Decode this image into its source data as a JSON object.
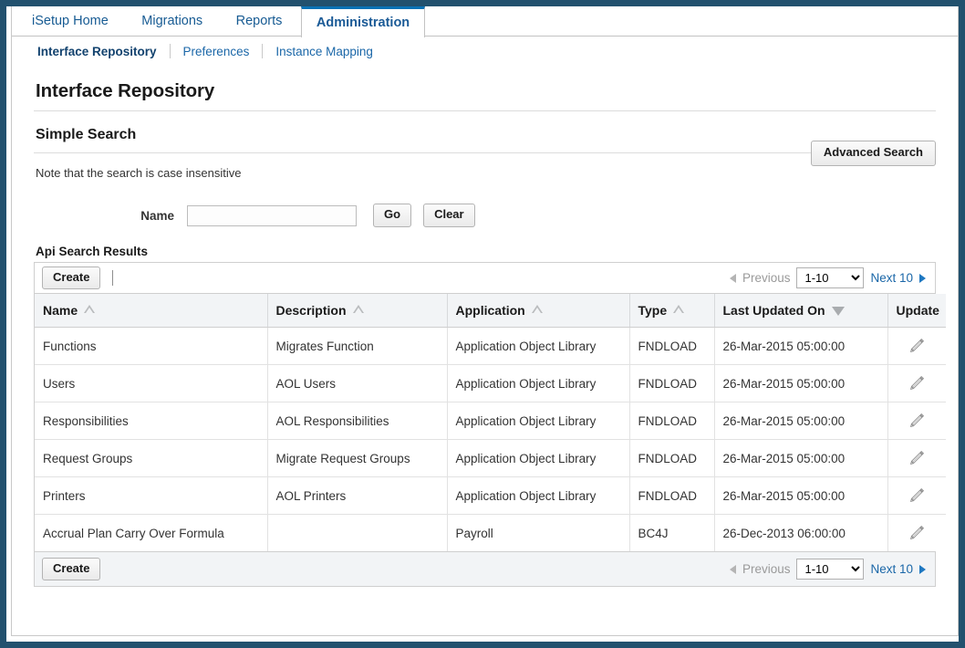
{
  "tabs": [
    {
      "label": "iSetup Home",
      "active": false
    },
    {
      "label": "Migrations",
      "active": false
    },
    {
      "label": "Reports",
      "active": false
    },
    {
      "label": "Administration",
      "active": true
    }
  ],
  "subnav": [
    {
      "label": "Interface Repository",
      "active": true
    },
    {
      "label": "Preferences",
      "active": false
    },
    {
      "label": "Instance Mapping",
      "active": false
    }
  ],
  "page": {
    "title": "Interface Repository",
    "section_title": "Simple Search",
    "note": "Note that the search is case insensitive",
    "results_label": "Api Search Results"
  },
  "search": {
    "advanced_label": "Advanced Search",
    "name_label": "Name",
    "name_value": "",
    "name_placeholder": "",
    "go_label": "Go",
    "clear_label": "Clear"
  },
  "toolbar": {
    "create_label": "Create"
  },
  "pager": {
    "previous_label": "Previous",
    "range_value": "1-10",
    "range_options": [
      "1-10"
    ],
    "next_label": "Next 10"
  },
  "table": {
    "columns": [
      {
        "label": "Name",
        "sort": "asc"
      },
      {
        "label": "Description",
        "sort": "asc"
      },
      {
        "label": "Application",
        "sort": "asc"
      },
      {
        "label": "Type",
        "sort": "asc"
      },
      {
        "label": "Last Updated On",
        "sort": "desc"
      },
      {
        "label": "Update",
        "sort": "none"
      }
    ],
    "rows": [
      {
        "name": "Functions",
        "description": "Migrates Function",
        "application": "Application Object Library",
        "type": "FNDLOAD",
        "last_updated_on": "26-Mar-2015 05:00:00",
        "update_icon": "pencil-icon"
      },
      {
        "name": "Users",
        "description": "AOL Users",
        "application": "Application Object Library",
        "type": "FNDLOAD",
        "last_updated_on": "26-Mar-2015 05:00:00",
        "update_icon": "pencil-icon"
      },
      {
        "name": "Responsibilities",
        "description": "AOL Responsibilities",
        "application": "Application Object Library",
        "type": "FNDLOAD",
        "last_updated_on": "26-Mar-2015 05:00:00",
        "update_icon": "pencil-icon"
      },
      {
        "name": "Request Groups",
        "description": "Migrate Request Groups",
        "application": "Application Object Library",
        "type": "FNDLOAD",
        "last_updated_on": "26-Mar-2015 05:00:00",
        "update_icon": "pencil-icon"
      },
      {
        "name": "Printers",
        "description": "AOL Printers",
        "application": "Application Object Library",
        "type": "FNDLOAD",
        "last_updated_on": "26-Mar-2015 05:00:00",
        "update_icon": "pencil-icon"
      },
      {
        "name": "Accrual Plan Carry Over Formula",
        "description": "",
        "application": "Payroll",
        "type": "BC4J",
        "last_updated_on": "26-Dec-2013 06:00:00",
        "update_icon": "pencil-icon"
      }
    ]
  },
  "colors": {
    "window_border": "#22516e",
    "tab_active_top": "#0a72b5",
    "link": "#1b67a8",
    "header_bg": "#f2f4f6",
    "sort_desc": "#a9acaf"
  }
}
